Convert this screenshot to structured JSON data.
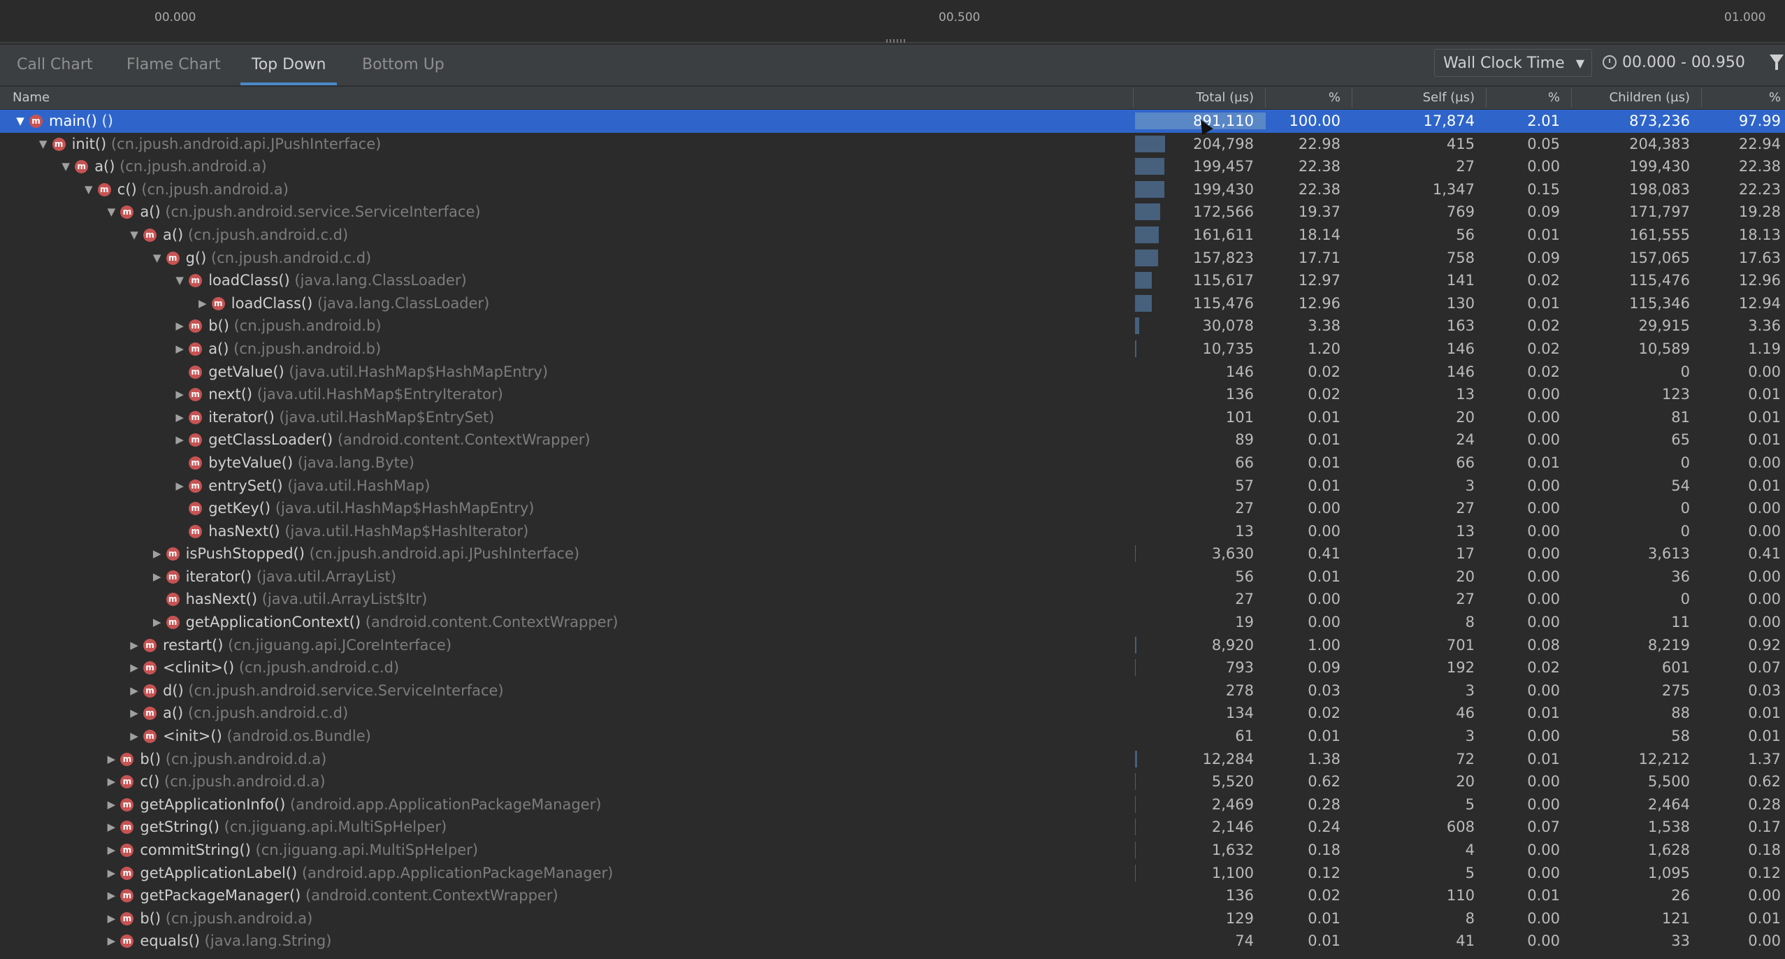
{
  "ruler": {
    "labels": [
      "00.000",
      "00.500",
      "01.000"
    ]
  },
  "tabs": [
    {
      "label": "Call Chart",
      "active": false
    },
    {
      "label": "Flame Chart",
      "active": false
    },
    {
      "label": "Top Down",
      "active": true
    },
    {
      "label": "Bottom Up",
      "active": false
    }
  ],
  "clock": {
    "selected": "Wall Clock Time",
    "range": "00.000 - 00.950"
  },
  "table": {
    "headers": {
      "name": "Name",
      "total": "Total (µs)",
      "total_pct": "%",
      "self": "Self (µs)",
      "self_pct": "%",
      "children": "Children (µs)",
      "children_pct": "%"
    },
    "selected_row": 0,
    "rows": [
      {
        "depth": 0,
        "exp": "down",
        "icon": "m",
        "method": "main()",
        "cls": "()",
        "total": "891,110",
        "tp": "100.00",
        "self": "17,874",
        "sp": "2.01",
        "children": "873,236",
        "cp": "97.99",
        "bar": 1.0
      },
      {
        "depth": 1,
        "exp": "down",
        "icon": "m",
        "method": "init()",
        "cls": "(cn.jpush.android.api.JPushInterface)",
        "total": "204,798",
        "tp": "22.98",
        "self": "415",
        "sp": "0.05",
        "children": "204,383",
        "cp": "22.94",
        "bar": 0.2298
      },
      {
        "depth": 2,
        "exp": "down",
        "icon": "m",
        "method": "a()",
        "cls": "(cn.jpush.android.a)",
        "total": "199,457",
        "tp": "22.38",
        "self": "27",
        "sp": "0.00",
        "children": "199,430",
        "cp": "22.38",
        "bar": 0.2238
      },
      {
        "depth": 3,
        "exp": "down",
        "icon": "m",
        "method": "c()",
        "cls": "(cn.jpush.android.a)",
        "total": "199,430",
        "tp": "22.38",
        "self": "1,347",
        "sp": "0.15",
        "children": "198,083",
        "cp": "22.23",
        "bar": 0.2238
      },
      {
        "depth": 4,
        "exp": "down",
        "icon": "m",
        "method": "a()",
        "cls": "(cn.jpush.android.service.ServiceInterface)",
        "total": "172,566",
        "tp": "19.37",
        "self": "769",
        "sp": "0.09",
        "children": "171,797",
        "cp": "19.28",
        "bar": 0.1937
      },
      {
        "depth": 5,
        "exp": "down",
        "icon": "m",
        "method": "a()",
        "cls": "(cn.jpush.android.c.d)",
        "total": "161,611",
        "tp": "18.14",
        "self": "56",
        "sp": "0.01",
        "children": "161,555",
        "cp": "18.13",
        "bar": 0.1814
      },
      {
        "depth": 6,
        "exp": "down",
        "icon": "m",
        "method": "g()",
        "cls": "(cn.jpush.android.c.d)",
        "total": "157,823",
        "tp": "17.71",
        "self": "758",
        "sp": "0.09",
        "children": "157,065",
        "cp": "17.63",
        "bar": 0.1771
      },
      {
        "depth": 7,
        "exp": "down",
        "icon": "m",
        "method": "loadClass()",
        "cls": "(java.lang.ClassLoader)",
        "total": "115,617",
        "tp": "12.97",
        "self": "141",
        "sp": "0.02",
        "children": "115,476",
        "cp": "12.96",
        "bar": 0.1297
      },
      {
        "depth": 8,
        "exp": "right",
        "icon": "m",
        "method": "loadClass()",
        "cls": "(java.lang.ClassLoader)",
        "total": "115,476",
        "tp": "12.96",
        "self": "130",
        "sp": "0.01",
        "children": "115,346",
        "cp": "12.94",
        "bar": 0.1296
      },
      {
        "depth": 7,
        "exp": "right",
        "icon": "m",
        "method": "b()",
        "cls": "(cn.jpush.android.b)",
        "total": "30,078",
        "tp": "3.38",
        "self": "163",
        "sp": "0.02",
        "children": "29,915",
        "cp": "3.36",
        "bar": 0.0338
      },
      {
        "depth": 7,
        "exp": "right",
        "icon": "m",
        "method": "a()",
        "cls": "(cn.jpush.android.b)",
        "total": "10,735",
        "tp": "1.20",
        "self": "146",
        "sp": "0.02",
        "children": "10,589",
        "cp": "1.19",
        "bar": 0.012
      },
      {
        "depth": 7,
        "exp": "none",
        "icon": "m",
        "method": "getValue()",
        "cls": "(java.util.HashMap$HashMapEntry)",
        "total": "146",
        "tp": "0.02",
        "self": "146",
        "sp": "0.02",
        "children": "0",
        "cp": "0.00",
        "bar": 0.0002
      },
      {
        "depth": 7,
        "exp": "right",
        "icon": "m",
        "method": "next()",
        "cls": "(java.util.HashMap$EntryIterator)",
        "total": "136",
        "tp": "0.02",
        "self": "13",
        "sp": "0.00",
        "children": "123",
        "cp": "0.01",
        "bar": 0.0002
      },
      {
        "depth": 7,
        "exp": "right",
        "icon": "m",
        "method": "iterator()",
        "cls": "(java.util.HashMap$EntrySet)",
        "total": "101",
        "tp": "0.01",
        "self": "20",
        "sp": "0.00",
        "children": "81",
        "cp": "0.01",
        "bar": 0.0001
      },
      {
        "depth": 7,
        "exp": "right",
        "icon": "m",
        "method": "getClassLoader()",
        "cls": "(android.content.ContextWrapper)",
        "total": "89",
        "tp": "0.01",
        "self": "24",
        "sp": "0.00",
        "children": "65",
        "cp": "0.01",
        "bar": 0.0001
      },
      {
        "depth": 7,
        "exp": "none",
        "icon": "m",
        "method": "byteValue()",
        "cls": "(java.lang.Byte)",
        "total": "66",
        "tp": "0.01",
        "self": "66",
        "sp": "0.01",
        "children": "0",
        "cp": "0.00",
        "bar": 0.0001
      },
      {
        "depth": 7,
        "exp": "right",
        "icon": "m",
        "method": "entrySet()",
        "cls": "(java.util.HashMap)",
        "total": "57",
        "tp": "0.01",
        "self": "3",
        "sp": "0.00",
        "children": "54",
        "cp": "0.01",
        "bar": 0.0001
      },
      {
        "depth": 7,
        "exp": "none",
        "icon": "m",
        "method": "getKey()",
        "cls": "(java.util.HashMap$HashMapEntry)",
        "total": "27",
        "tp": "0.00",
        "self": "27",
        "sp": "0.00",
        "children": "0",
        "cp": "0.00",
        "bar": 0.0
      },
      {
        "depth": 7,
        "exp": "none",
        "icon": "m",
        "method": "hasNext()",
        "cls": "(java.util.HashMap$HashIterator)",
        "total": "13",
        "tp": "0.00",
        "self": "13",
        "sp": "0.00",
        "children": "0",
        "cp": "0.00",
        "bar": 0.0
      },
      {
        "depth": 6,
        "exp": "right",
        "icon": "m",
        "method": "isPushStopped()",
        "cls": "(cn.jpush.android.api.JPushInterface)",
        "total": "3,630",
        "tp": "0.41",
        "self": "17",
        "sp": "0.00",
        "children": "3,613",
        "cp": "0.41",
        "bar": 0.0041
      },
      {
        "depth": 6,
        "exp": "right",
        "icon": "m",
        "method": "iterator()",
        "cls": "(java.util.ArrayList)",
        "total": "56",
        "tp": "0.01",
        "self": "20",
        "sp": "0.00",
        "children": "36",
        "cp": "0.00",
        "bar": 0.0001
      },
      {
        "depth": 6,
        "exp": "none",
        "icon": "m",
        "method": "hasNext()",
        "cls": "(java.util.ArrayList$Itr)",
        "total": "27",
        "tp": "0.00",
        "self": "27",
        "sp": "0.00",
        "children": "0",
        "cp": "0.00",
        "bar": 0.0
      },
      {
        "depth": 6,
        "exp": "right",
        "icon": "m",
        "method": "getApplicationContext()",
        "cls": "(android.content.ContextWrapper)",
        "total": "19",
        "tp": "0.00",
        "self": "8",
        "sp": "0.00",
        "children": "11",
        "cp": "0.00",
        "bar": 0.0
      },
      {
        "depth": 5,
        "exp": "right",
        "icon": "m",
        "method": "restart()",
        "cls": "(cn.jiguang.api.JCoreInterface)",
        "total": "8,920",
        "tp": "1.00",
        "self": "701",
        "sp": "0.08",
        "children": "8,219",
        "cp": "0.92",
        "bar": 0.01
      },
      {
        "depth": 5,
        "exp": "right",
        "icon": "m",
        "method": "<clinit>()",
        "cls": "(cn.jpush.android.c.d)",
        "total": "793",
        "tp": "0.09",
        "self": "192",
        "sp": "0.02",
        "children": "601",
        "cp": "0.07",
        "bar": 0.0009
      },
      {
        "depth": 5,
        "exp": "right",
        "icon": "m",
        "method": "d()",
        "cls": "(cn.jpush.android.service.ServiceInterface)",
        "total": "278",
        "tp": "0.03",
        "self": "3",
        "sp": "0.00",
        "children": "275",
        "cp": "0.03",
        "bar": 0.0003
      },
      {
        "depth": 5,
        "exp": "right",
        "icon": "m",
        "method": "a()",
        "cls": "(cn.jpush.android.c.d)",
        "total": "134",
        "tp": "0.02",
        "self": "46",
        "sp": "0.01",
        "children": "88",
        "cp": "0.01",
        "bar": 0.0002
      },
      {
        "depth": 5,
        "exp": "right",
        "icon": "m",
        "method": "<init>()",
        "cls": "(android.os.Bundle)",
        "total": "61",
        "tp": "0.01",
        "self": "3",
        "sp": "0.00",
        "children": "58",
        "cp": "0.01",
        "bar": 0.0001
      },
      {
        "depth": 4,
        "exp": "right",
        "icon": "m",
        "method": "b()",
        "cls": "(cn.jpush.android.d.a)",
        "total": "12,284",
        "tp": "1.38",
        "self": "72",
        "sp": "0.01",
        "children": "12,212",
        "cp": "1.37",
        "bar": 0.0138
      },
      {
        "depth": 4,
        "exp": "right",
        "icon": "m",
        "method": "c()",
        "cls": "(cn.jpush.android.d.a)",
        "total": "5,520",
        "tp": "0.62",
        "self": "20",
        "sp": "0.00",
        "children": "5,500",
        "cp": "0.62",
        "bar": 0.0062
      },
      {
        "depth": 4,
        "exp": "right",
        "icon": "m",
        "method": "getApplicationInfo()",
        "cls": "(android.app.ApplicationPackageManager)",
        "total": "2,469",
        "tp": "0.28",
        "self": "5",
        "sp": "0.00",
        "children": "2,464",
        "cp": "0.28",
        "bar": 0.0028
      },
      {
        "depth": 4,
        "exp": "right",
        "icon": "m",
        "method": "getString()",
        "cls": "(cn.jiguang.api.MultiSpHelper)",
        "total": "2,146",
        "tp": "0.24",
        "self": "608",
        "sp": "0.07",
        "children": "1,538",
        "cp": "0.17",
        "bar": 0.0024
      },
      {
        "depth": 4,
        "exp": "right",
        "icon": "m",
        "method": "commitString()",
        "cls": "(cn.jiguang.api.MultiSpHelper)",
        "total": "1,632",
        "tp": "0.18",
        "self": "4",
        "sp": "0.00",
        "children": "1,628",
        "cp": "0.18",
        "bar": 0.0018
      },
      {
        "depth": 4,
        "exp": "right",
        "icon": "m",
        "method": "getApplicationLabel()",
        "cls": "(android.app.ApplicationPackageManager)",
        "total": "1,100",
        "tp": "0.12",
        "self": "5",
        "sp": "0.00",
        "children": "1,095",
        "cp": "0.12",
        "bar": 0.0012
      },
      {
        "depth": 4,
        "exp": "right",
        "icon": "m",
        "method": "getPackageManager()",
        "cls": "(android.content.ContextWrapper)",
        "total": "136",
        "tp": "0.02",
        "self": "110",
        "sp": "0.01",
        "children": "26",
        "cp": "0.00",
        "bar": 0.0002
      },
      {
        "depth": 4,
        "exp": "right",
        "icon": "m",
        "method": "b()",
        "cls": "(cn.jpush.android.a)",
        "total": "129",
        "tp": "0.01",
        "self": "8",
        "sp": "0.00",
        "children": "121",
        "cp": "0.01",
        "bar": 0.0001
      },
      {
        "depth": 4,
        "exp": "right",
        "icon": "m",
        "method": "equals()",
        "cls": "(java.lang.String)",
        "total": "74",
        "tp": "0.01",
        "self": "41",
        "sp": "0.00",
        "children": "33",
        "cp": "0.00",
        "bar": 0.0001
      }
    ]
  }
}
